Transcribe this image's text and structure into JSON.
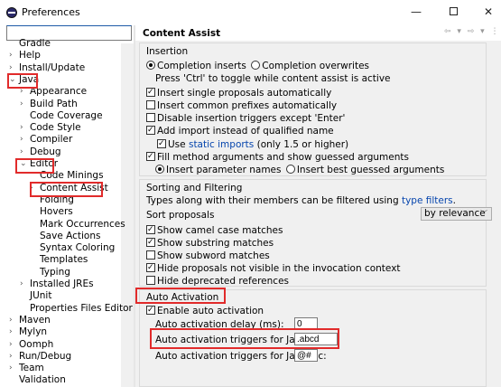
{
  "window": {
    "title": "Preferences",
    "min": "—",
    "close": "✕"
  },
  "sidebar": {
    "filter_value": "",
    "items": [
      {
        "label": "Gradle",
        "level": 1,
        "arrow": ""
      },
      {
        "label": "Help",
        "level": 1,
        "arrow": "›"
      },
      {
        "label": "Install/Update",
        "level": 1,
        "arrow": "›"
      },
      {
        "label": "Java",
        "level": 1,
        "arrow": "⌄"
      },
      {
        "label": "Appearance",
        "level": 2,
        "arrow": "›"
      },
      {
        "label": "Build Path",
        "level": 2,
        "arrow": "›"
      },
      {
        "label": "Code Coverage",
        "level": 2,
        "arrow": ""
      },
      {
        "label": "Code Style",
        "level": 2,
        "arrow": "›"
      },
      {
        "label": "Compiler",
        "level": 2,
        "arrow": "›"
      },
      {
        "label": "Debug",
        "level": 2,
        "arrow": "›"
      },
      {
        "label": "Editor",
        "level": 2,
        "arrow": "⌄"
      },
      {
        "label": "Code Minings",
        "level": 3,
        "arrow": ""
      },
      {
        "label": "Content Assist",
        "level": 3,
        "arrow": "›"
      },
      {
        "label": "Folding",
        "level": 3,
        "arrow": ""
      },
      {
        "label": "Hovers",
        "level": 3,
        "arrow": ""
      },
      {
        "label": "Mark Occurrences",
        "level": 3,
        "arrow": ""
      },
      {
        "label": "Save Actions",
        "level": 3,
        "arrow": ""
      },
      {
        "label": "Syntax Coloring",
        "level": 3,
        "arrow": ""
      },
      {
        "label": "Templates",
        "level": 3,
        "arrow": ""
      },
      {
        "label": "Typing",
        "level": 3,
        "arrow": ""
      },
      {
        "label": "Installed JREs",
        "level": 2,
        "arrow": "›"
      },
      {
        "label": "JUnit",
        "level": 2,
        "arrow": ""
      },
      {
        "label": "Properties Files Editor",
        "level": 2,
        "arrow": ""
      },
      {
        "label": "Maven",
        "level": 1,
        "arrow": "›"
      },
      {
        "label": "Mylyn",
        "level": 1,
        "arrow": "›"
      },
      {
        "label": "Oomph",
        "level": 1,
        "arrow": "›"
      },
      {
        "label": "Run/Debug",
        "level": 1,
        "arrow": "›"
      },
      {
        "label": "Team",
        "level": 1,
        "arrow": "›"
      },
      {
        "label": "Validation",
        "level": 1,
        "arrow": ""
      }
    ],
    "selected": "Content Assist"
  },
  "page": {
    "title": "Content Assist",
    "nav_icons": "⇦ ▾ ⇨ ▾ ⋮",
    "insertion": {
      "label": "Insertion",
      "completion_inserts": "Completion inserts",
      "completion_overwrites": "Completion overwrites",
      "toggle_hint": "Press 'Ctrl' to toggle while content assist is active",
      "single_proposals": "Insert single proposals automatically",
      "common_prefixes": "Insert common prefixes automatically",
      "disable_triggers": "Disable insertion triggers except 'Enter'",
      "add_import": "Add import instead of qualified name",
      "use_label": "Use",
      "static_imports": "static imports",
      "only_version": "(only 1.5 or higher)",
      "fill_args": "Fill method arguments and show guessed arguments",
      "param_names": "Insert parameter names",
      "best_guessed": "Insert best guessed arguments"
    },
    "sorting": {
      "label": "Sorting and Filtering",
      "types_text": "Types along with their members can be filtered using",
      "type_filters": "type filters",
      "period": ".",
      "sort_label": "Sort proposals",
      "sort_value": "by relevance",
      "camel": "Show camel case matches",
      "substring": "Show substring matches",
      "subword": "Show subword matches",
      "hide_invocation": "Hide proposals not visible in the invocation context",
      "hide_deprecated": "Hide deprecated references"
    },
    "auto_activation": {
      "label": "Auto Activation",
      "enable": "Enable auto activation",
      "delay_label": "Auto activation delay (ms):",
      "delay_value": "0",
      "java_label": "Auto activation triggers for Java:",
      "java_value": ".abcd",
      "javadoc_label": "Auto activation triggers for Javadoc:",
      "javadoc_value": "@#"
    }
  },
  "colors": {
    "highlight_box": "#e12b2b",
    "link": "#0645ad",
    "panel_bg": "#f0f0f0"
  }
}
